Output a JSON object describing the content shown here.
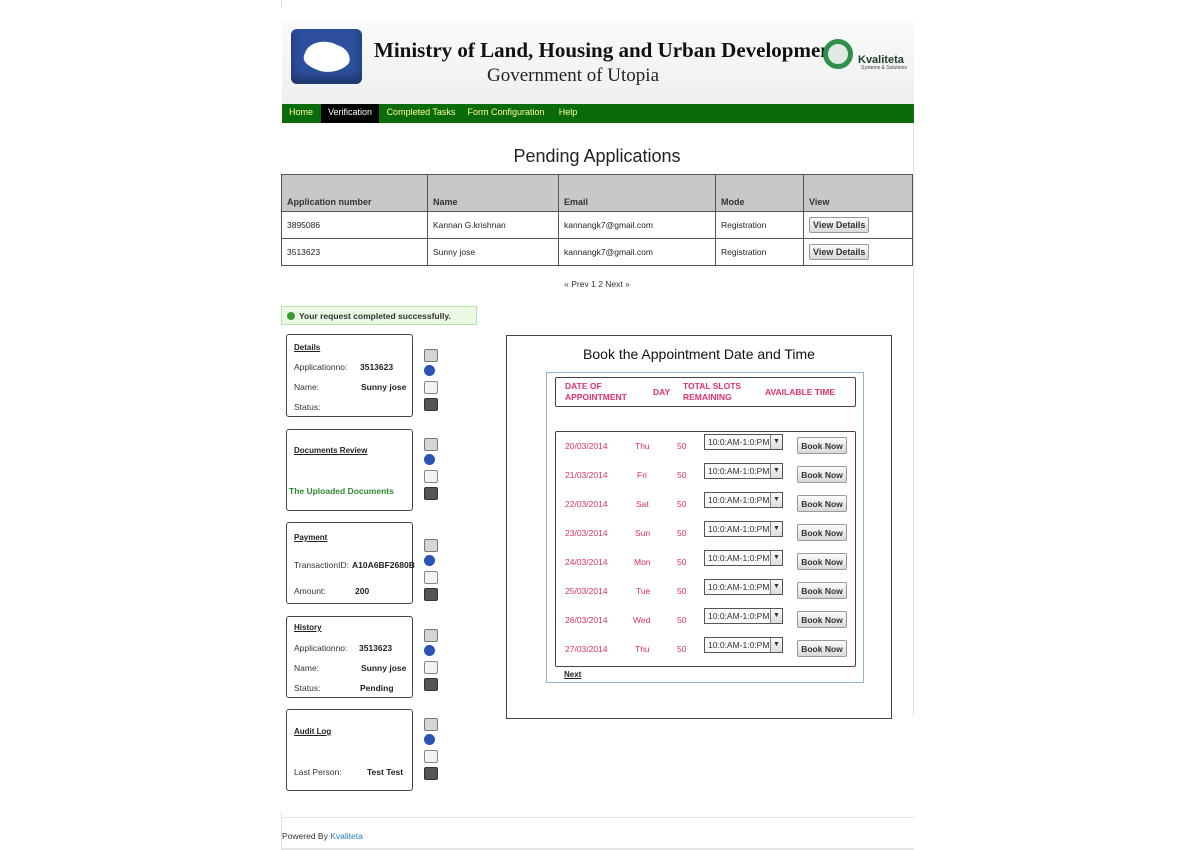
{
  "header": {
    "ministry": "Ministry of Land, Housing and Urban Development",
    "government": "Government of Utopia",
    "logo_name": "Kvaliteta",
    "logo_tagline": "Systems & Solutions"
  },
  "nav": {
    "items": [
      {
        "label": "Home",
        "active": false
      },
      {
        "label": "Verification",
        "active": true
      },
      {
        "label": "Completed Tasks",
        "active": false
      },
      {
        "label": "Form Configuration",
        "active": false
      },
      {
        "label": "Help",
        "active": false
      }
    ]
  },
  "page_title": "Pending Applications",
  "table": {
    "headers": [
      "Application number",
      "Name",
      "Email",
      "Mode",
      "View"
    ],
    "rows": [
      {
        "app_no": "3895086",
        "name": "Kannan G.krishnan",
        "email": "kannangk7@gmail.com",
        "mode": "Registration",
        "action": "View Details"
      },
      {
        "app_no": "3513623",
        "name": "Sunny jose",
        "email": "kannangk7@gmail.com",
        "mode": "Registration",
        "action": "View Details"
      }
    ]
  },
  "pager": {
    "prev": "« Prev",
    "page1": "1",
    "page2": "2",
    "next": "Next »"
  },
  "success_message": "Your request completed successfully.",
  "panels": {
    "details": {
      "title": "Details",
      "app_label": "Applicationno:",
      "app_value": "3513623",
      "name_label": "Name:",
      "name_value": "Sunny jose",
      "status_label": "Status:"
    },
    "documents": {
      "title": "Documents Review",
      "link": "The Uploaded Documents"
    },
    "payment": {
      "title": "Payment",
      "txn_label": "TransactionID:",
      "txn_value": "A10A6BF2680B",
      "amount_label": "Amount:",
      "amount_value": "200"
    },
    "history": {
      "title": "History",
      "app_label": "Applicationno:",
      "app_value": "3513623",
      "name_label": "Name:",
      "name_value": "Sunny jose",
      "status_label": "Status:",
      "status_value": "Pending"
    },
    "audit": {
      "title": "Audit Log",
      "person_label": "Last Person:",
      "person_value": "Test Test"
    }
  },
  "booking": {
    "title": "Book the Appointment Date and Time",
    "col_date": "DATE OF APPOINTMENT",
    "col_day": "DAY",
    "col_slots": "TOTAL SLOTS REMAINING",
    "col_time": "AVAILABLE TIME",
    "button_label": "Book Now",
    "next_label": "Next",
    "rows": [
      {
        "date": "20/03/2014",
        "day": "Thu",
        "slots": "50",
        "time": "10:0:AM-1:0:PM"
      },
      {
        "date": "21/03/2014",
        "day": "Fri",
        "slots": "50",
        "time": "10:0:AM-1:0:PM"
      },
      {
        "date": "22/03/2014",
        "day": "Sat",
        "slots": "50",
        "time": "10:0:AM-1:0:PM"
      },
      {
        "date": "23/03/2014",
        "day": "Sun",
        "slots": "50",
        "time": "10:0:AM-1:0:PM"
      },
      {
        "date": "24/03/2014",
        "day": "Mon",
        "slots": "50",
        "time": "10:0:AM-1:0:PM"
      },
      {
        "date": "25/03/2014",
        "day": "Tue",
        "slots": "50",
        "time": "10:0:AM-1:0:PM"
      },
      {
        "date": "26/03/2014",
        "day": "Wed",
        "slots": "50",
        "time": "10:0:AM-1:0:PM"
      },
      {
        "date": "27/03/2014",
        "day": "Thu",
        "slots": "50",
        "time": "10:0:AM-1:0:PM"
      }
    ]
  },
  "footer": {
    "prefix": "Powered By",
    "link": "Kvaliteta"
  },
  "colors": {
    "nav_bg": "#096b0a",
    "nav_text": "#fffd99",
    "accent_red": "#e0316d",
    "success_bg": "#eaf8e4"
  }
}
